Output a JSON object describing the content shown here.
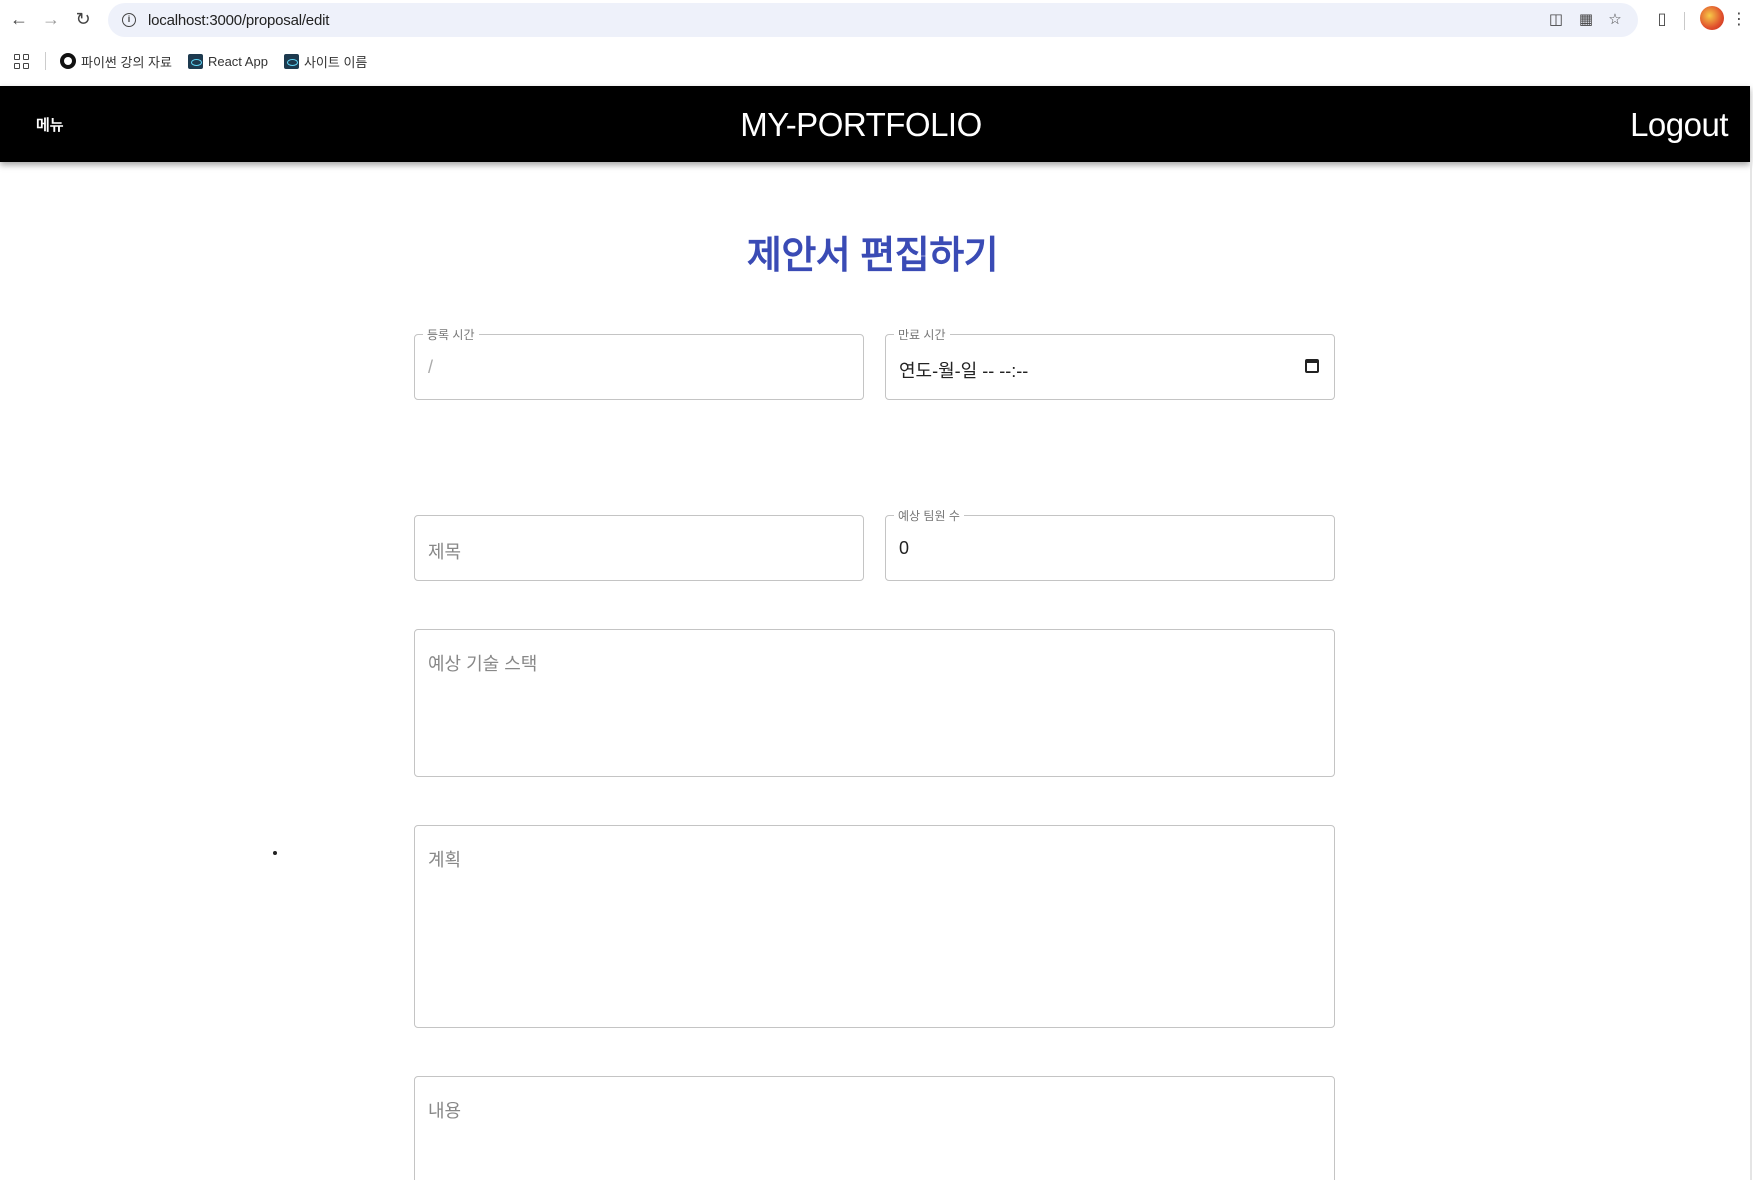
{
  "browser": {
    "url": "localhost:3000/proposal/edit",
    "bookmarks": [
      {
        "label": "파이썬 강의 자료"
      },
      {
        "label": "React App"
      },
      {
        "label": "사이트 이름"
      }
    ]
  },
  "header": {
    "menu_label": "메뉴",
    "title": "MY-PORTFOLIO",
    "logout_label": "Logout"
  },
  "page": {
    "title": "제안서 편집하기"
  },
  "form": {
    "registered_time": {
      "label": "등록 시간",
      "value": "/"
    },
    "end_time": {
      "label": "만료 시간",
      "value": "연도-월-일 -- --:--"
    },
    "title": {
      "placeholder": "제목"
    },
    "team_size": {
      "label": "예상 팀원 수",
      "value": "0"
    },
    "tech_stack": {
      "placeholder": "예상 기술 스택"
    },
    "plan": {
      "placeholder": "계획"
    },
    "content": {
      "placeholder": "내용"
    }
  }
}
